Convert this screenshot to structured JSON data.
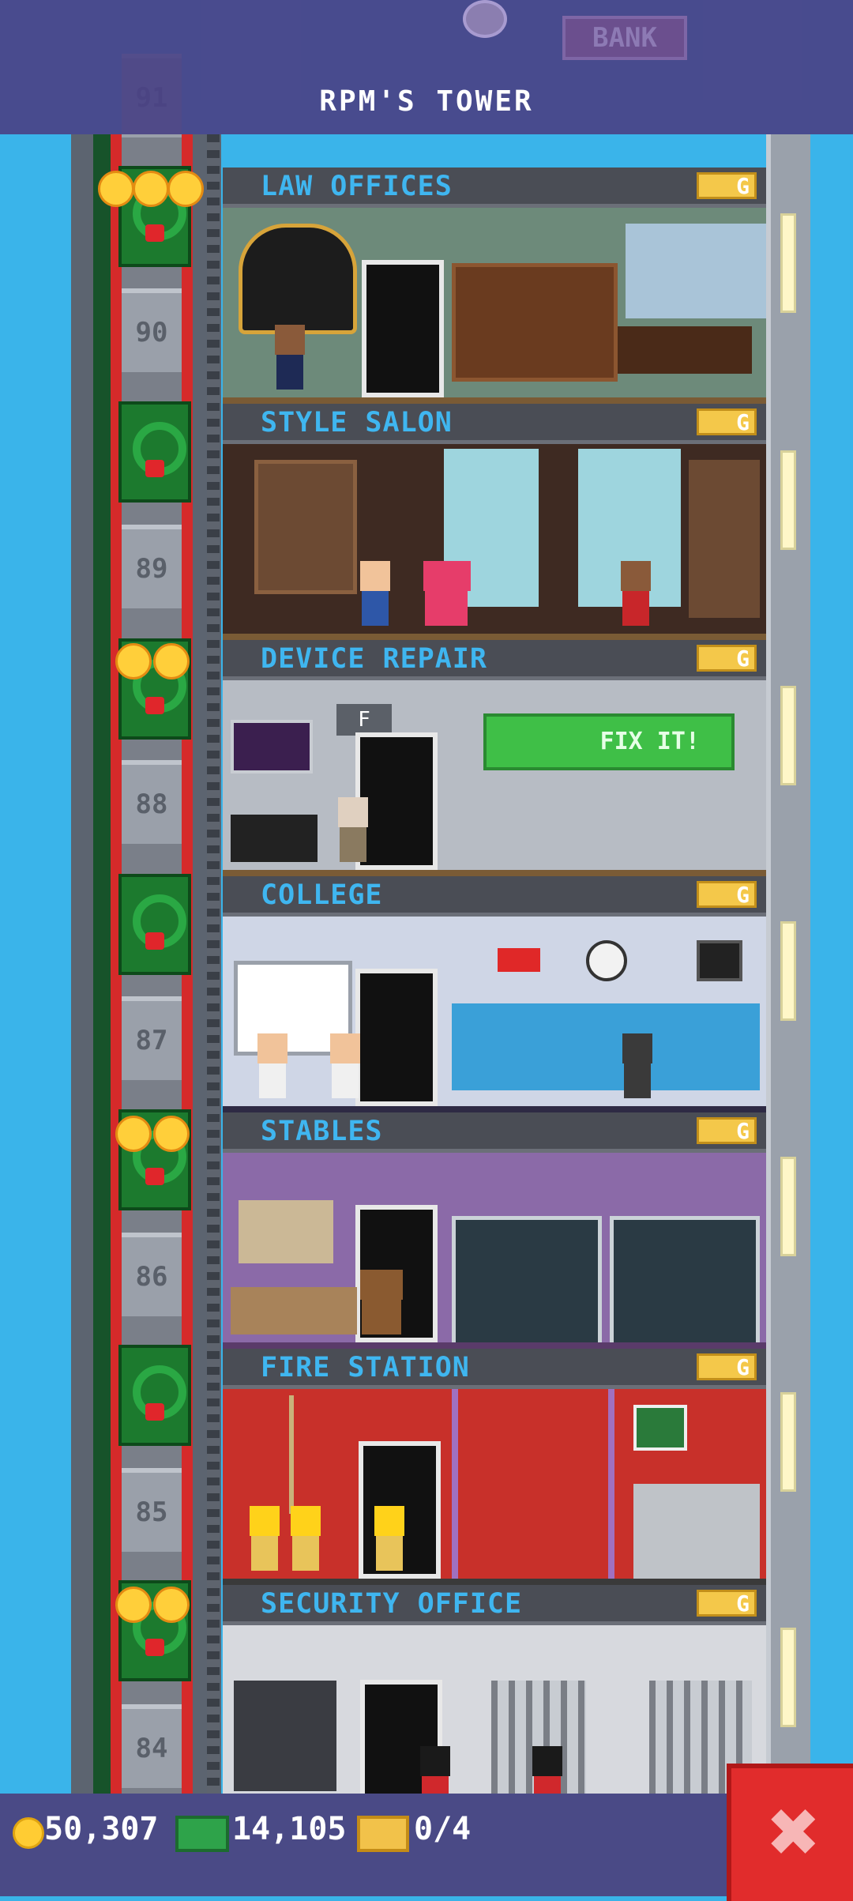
{
  "tower": {
    "title": "RPM'S TOWER",
    "top_sign": "BANK"
  },
  "colors": {
    "sky": "#3ab4ea",
    "floor_label": "#3fb6f0",
    "bar": "#4a4a86",
    "close_button": "#e12c2c"
  },
  "elevator": {
    "floor_numbers": [
      "91",
      "90",
      "89",
      "88",
      "87",
      "86",
      "85",
      "84"
    ],
    "decoration_icon": "christmas-wreath-icon"
  },
  "floors": [
    {
      "name": "LAW OFFICES",
      "badge": "G",
      "stars": 3
    },
    {
      "name": "STYLE SALON",
      "badge": "G",
      "stars": 0
    },
    {
      "name": "DEVICE REPAIR",
      "badge": "G",
      "stars": 2,
      "sign": "FIX IT!",
      "door_label": "F"
    },
    {
      "name": "COLLEGE",
      "badge": "G",
      "stars": 0
    },
    {
      "name": "STABLES",
      "badge": "G",
      "stars": 2
    },
    {
      "name": "FIRE STATION",
      "badge": "G",
      "stars": 0
    },
    {
      "name": "SECURITY OFFICE",
      "badge": "G",
      "stars": 2
    }
  ],
  "status_bar": {
    "coins": "50,307",
    "bux": "14,105",
    "tickets": "0/4",
    "close_icon": "close-x-icon"
  }
}
